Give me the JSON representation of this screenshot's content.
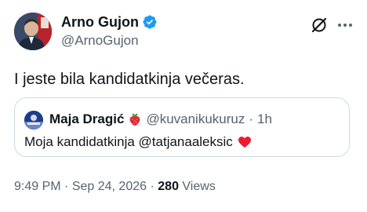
{
  "author": {
    "name": "Arno Gujon",
    "handle": "@ArnoGujon",
    "verified": true,
    "avatar_icon": "profile-photo"
  },
  "header_icons": [
    "grok-icon",
    "more-options-icon"
  ],
  "tweet_text": "I jeste bila kandidatkinja večeras.",
  "quoted_tweet": {
    "name": "Maja Dragić",
    "name_emoji": "strawberry-icon",
    "handle": "@kuvanikukuruz",
    "separator": "·",
    "time": "1h",
    "text": "Moja kandidatkinja @tatjanaaleksic",
    "text_emoji": "red-heart-icon"
  },
  "meta": {
    "time": "9:49 PM",
    "dot1": "·",
    "date": "Sep 24, 2026",
    "dot2": "·",
    "views_count": "280",
    "views_label": "Views"
  },
  "colors": {
    "text_primary": "#0f1419",
    "text_secondary": "#536471",
    "verified_blue": "#1d9bf0",
    "border": "#cfd9de"
  }
}
